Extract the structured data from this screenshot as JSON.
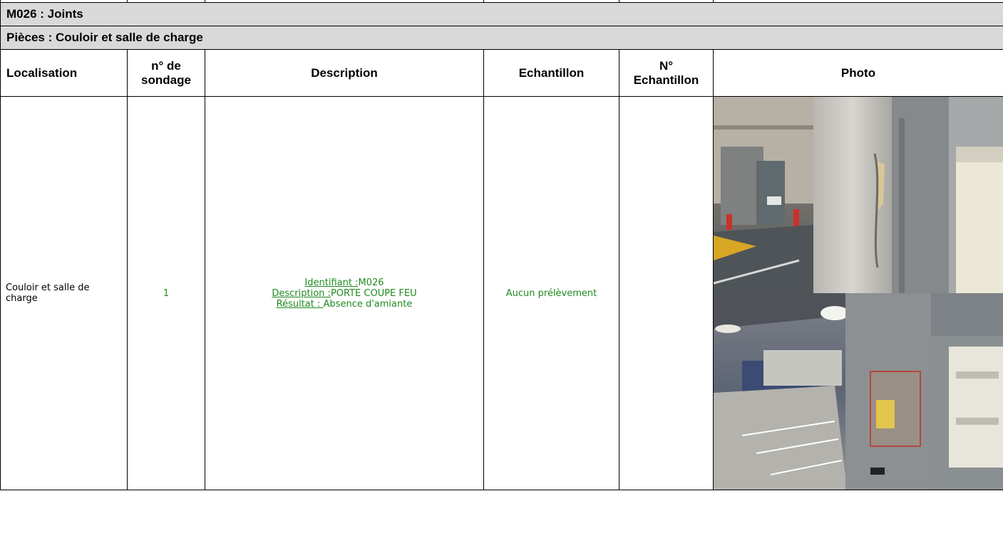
{
  "section_title": "M026 : Joints",
  "rooms_title": "Pièces : Couloir et salle de charge",
  "headers": {
    "localisation": "Localisation",
    "sondage_line1": "n° de",
    "sondage_line2": "sondage",
    "description": "Description",
    "echantillon": "Echantillon",
    "no_echantillon_line1": "N°",
    "no_echantillon_line2": "Echantillon",
    "photo": "Photo"
  },
  "row": {
    "localisation": "Couloir et salle de charge",
    "sondage": "1",
    "identifiant_label": "Identifiant :",
    "identifiant_value": "M026",
    "description_label": "Description :",
    "description_value": "PORTE COUPE FEU",
    "resultat_label": "Résultat : ",
    "resultat_value": " Absence d'amiante",
    "echantillon": "Aucun prélèvement",
    "no_echantillon": ""
  },
  "colors": {
    "banner_bg": "#d9d9d9",
    "value_text": "#1f8a1f",
    "border": "#000000"
  }
}
